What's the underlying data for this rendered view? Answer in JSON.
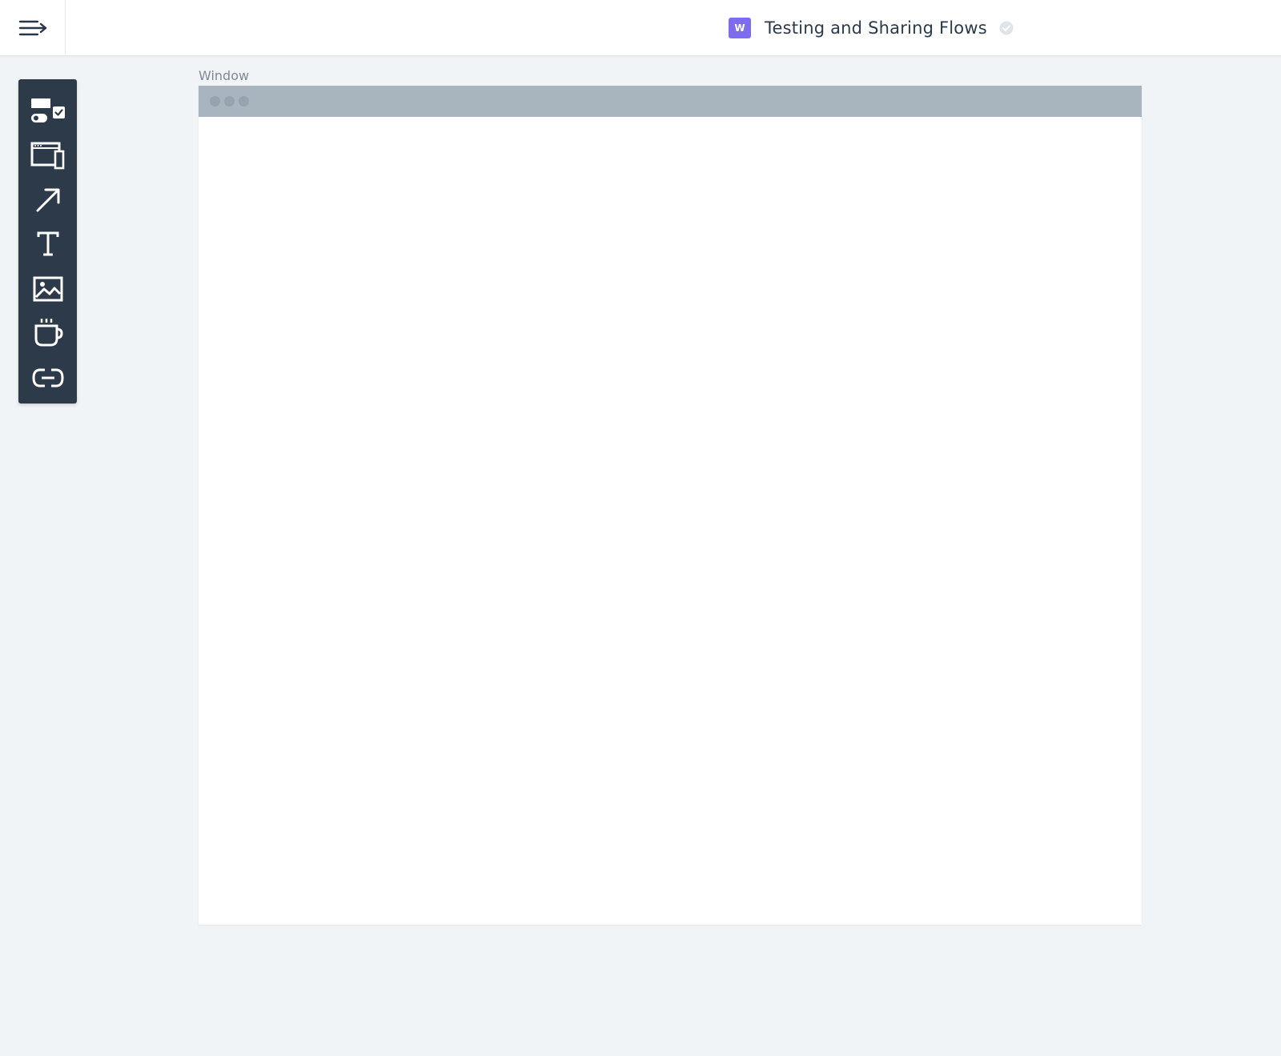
{
  "header": {
    "workspace_badge": "W",
    "title": "Testing and Sharing Flows",
    "icons": {
      "menu": "menu-collapse-icon",
      "status": "check-circle-icon"
    }
  },
  "toolbar": {
    "tools": [
      {
        "name": "components",
        "icon": "components-icon"
      },
      {
        "name": "screen",
        "icon": "screen-icon"
      },
      {
        "name": "arrow",
        "icon": "arrow-icon"
      },
      {
        "name": "text",
        "icon": "text-icon"
      },
      {
        "name": "image",
        "icon": "image-icon"
      },
      {
        "name": "cup",
        "icon": "cup-icon"
      },
      {
        "name": "link",
        "icon": "link-icon"
      }
    ]
  },
  "canvas": {
    "window_label": "Window"
  },
  "colors": {
    "background": "#f1f4f7",
    "toolbar": "#2d3a49",
    "badge": "#7b6cf0",
    "window_titlebar": "#a8b4be"
  }
}
